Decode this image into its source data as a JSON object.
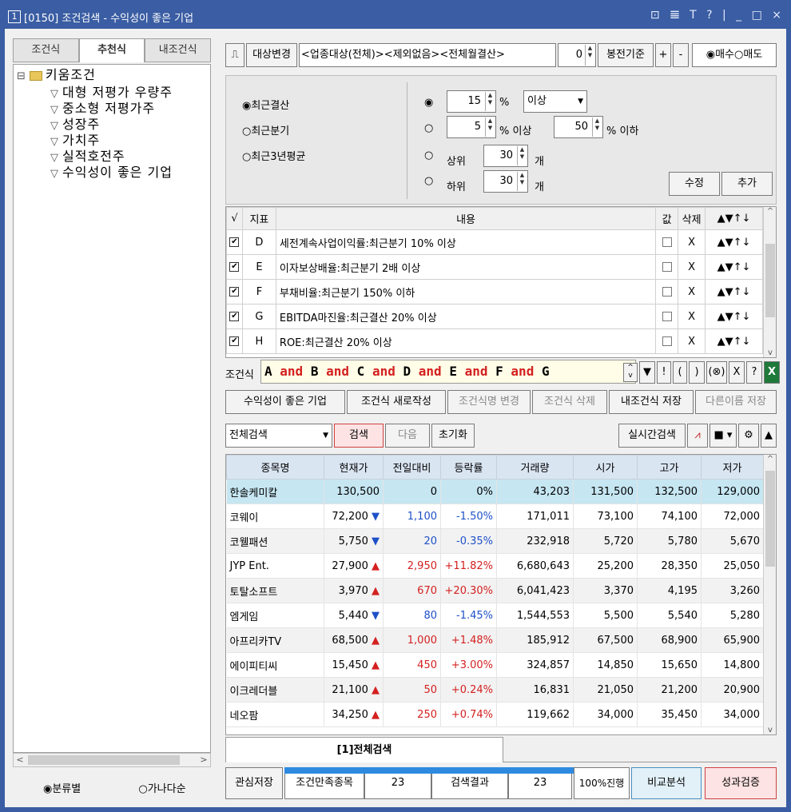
{
  "window": {
    "number": "1",
    "title": "[0150] 조건검색 - 수익성이 좋은 기업",
    "controls": "⊡ 𝌆 T ? | _ □ ×"
  },
  "left": {
    "tabs": [
      "조건식",
      "추천식",
      "내조건식"
    ],
    "tree": {
      "root": "키움조건",
      "items": [
        "대형 저평가 우량주",
        "중소형 저평가주",
        "성장주",
        "가치주",
        "실적호전주",
        "수익성이 좋은 기업"
      ]
    },
    "radios": [
      "분류별",
      "가나다순"
    ],
    "selected_radio": "분류별"
  },
  "toolbar": {
    "change_label": "대상변경",
    "target_text": "<업종대상(전체)><제외없음><전체월결산>",
    "bong_value": "0",
    "bong_label": "봉전기준",
    "plus": "+",
    "minus": "-",
    "buy": "매수",
    "sell": "매도",
    "selected": "매수"
  },
  "options": {
    "period": [
      "최근결산",
      "최근분기",
      "최근3년평균"
    ],
    "period_selected": "최근결산",
    "row1_value": "15",
    "row1_unit": "%",
    "row1_select": "이상",
    "row2_min": "5",
    "row2_min_label": "% 이상",
    "row2_max": "50",
    "row2_max_label": "% 이하",
    "row3_label": "상위",
    "row3_value": "30",
    "row3_unit": "개",
    "row4_label": "하위",
    "row4_value": "30",
    "row4_unit": "개",
    "edit_button": "수정",
    "add_button": "추가"
  },
  "condition_list": {
    "headers": [
      "√",
      "지표",
      "내용",
      "값",
      "삭제",
      "▲▼↑↓"
    ],
    "rows": [
      {
        "id": "D",
        "text": "세전계속사업이익률:최근분기 10% 이상"
      },
      {
        "id": "E",
        "text": "이자보상배율:최근분기 2배 이상"
      },
      {
        "id": "F",
        "text": "부채비율:최근분기 150% 이하"
      },
      {
        "id": "G",
        "text": "EBITDA마진율:최근결산 20% 이상"
      },
      {
        "id": "H",
        "text": "ROE:최근결산 20% 이상"
      }
    ],
    "delete_mark": "X",
    "move_marks": "▲▼↑↓"
  },
  "formula": {
    "label": "조건식",
    "tokens": [
      "A",
      "and",
      "B",
      "and",
      "C",
      "and",
      "D",
      "and",
      "E",
      "and",
      "F",
      "and",
      "G"
    ],
    "tools": [
      "▼",
      "!",
      "(",
      ")",
      "(⊗)",
      "X",
      "?"
    ]
  },
  "formula_buttons": {
    "name": "수익성이 좋은 기업",
    "new": "조건식 새로작성",
    "rename": "조건식명 변경",
    "delete": "조건식 삭제",
    "save": "내조건식 저장",
    "save_as": "다른이름 저장"
  },
  "search_bar": {
    "scope": "전체검색",
    "search": "검색",
    "next": "다음",
    "reset": "초기화",
    "realtime": "실시간검색"
  },
  "results": {
    "headers": [
      "종목명",
      "현재가",
      "전일대비",
      "등락률",
      "거래량",
      "시가",
      "고가",
      "저가"
    ],
    "rows": [
      {
        "name": "한솔케미칼",
        "price": "130,500",
        "dir": "",
        "chg": "0",
        "rate": "0%",
        "vol": "43,203",
        "open": "131,500",
        "high": "132,500",
        "low": "129,000"
      },
      {
        "name": "코웨이",
        "price": "72,200",
        "dir": "▼",
        "chg": "1,100",
        "rate": "-1.50%",
        "vol": "171,011",
        "open": "73,100",
        "high": "74,100",
        "low": "72,000"
      },
      {
        "name": "코웰패션",
        "price": "5,750",
        "dir": "▼",
        "chg": "20",
        "rate": "-0.35%",
        "vol": "232,918",
        "open": "5,720",
        "high": "5,780",
        "low": "5,670"
      },
      {
        "name": "JYP Ent.",
        "price": "27,900",
        "dir": "▲",
        "chg": "2,950",
        "rate": "+11.82%",
        "vol": "6,680,643",
        "open": "25,200",
        "high": "28,350",
        "low": "25,050"
      },
      {
        "name": "토탈소프트",
        "price": "3,970",
        "dir": "▲",
        "chg": "670",
        "rate": "+20.30%",
        "vol": "6,041,423",
        "open": "3,370",
        "high": "4,195",
        "low": "3,260"
      },
      {
        "name": "엠게임",
        "price": "5,440",
        "dir": "▼",
        "chg": "80",
        "rate": "-1.45%",
        "vol": "1,544,553",
        "open": "5,500",
        "high": "5,540",
        "low": "5,280"
      },
      {
        "name": "아프리카TV",
        "price": "68,500",
        "dir": "▲",
        "chg": "1,000",
        "rate": "+1.48%",
        "vol": "185,912",
        "open": "67,500",
        "high": "68,900",
        "low": "65,900"
      },
      {
        "name": "에이피티씨",
        "price": "15,450",
        "dir": "▲",
        "chg": "450",
        "rate": "+3.00%",
        "vol": "324,857",
        "open": "14,850",
        "high": "15,650",
        "low": "14,800"
      },
      {
        "name": "이크레더블",
        "price": "21,100",
        "dir": "▲",
        "chg": "50",
        "rate": "+0.24%",
        "vol": "16,831",
        "open": "21,050",
        "high": "21,200",
        "low": "20,900"
      },
      {
        "name": "네오팜",
        "price": "34,250",
        "dir": "▲",
        "chg": "250",
        "rate": "+0.74%",
        "vol": "119,662",
        "open": "34,000",
        "high": "35,450",
        "low": "34,000"
      }
    ]
  },
  "bottom": {
    "tab": "[1]전체검색",
    "watch_save": "관심저장",
    "match_label": "조건만족종목",
    "match_count": "23",
    "result_label": "검색결과",
    "result_count": "23",
    "progress": "100%진행",
    "progress_pct": 100,
    "compare": "비교분석",
    "verify": "성과검증"
  },
  "colors": {
    "title_bar": "#3a5da3",
    "up": "#d42020",
    "down": "#1e50c8",
    "selected_row": "#c6e6f2"
  }
}
